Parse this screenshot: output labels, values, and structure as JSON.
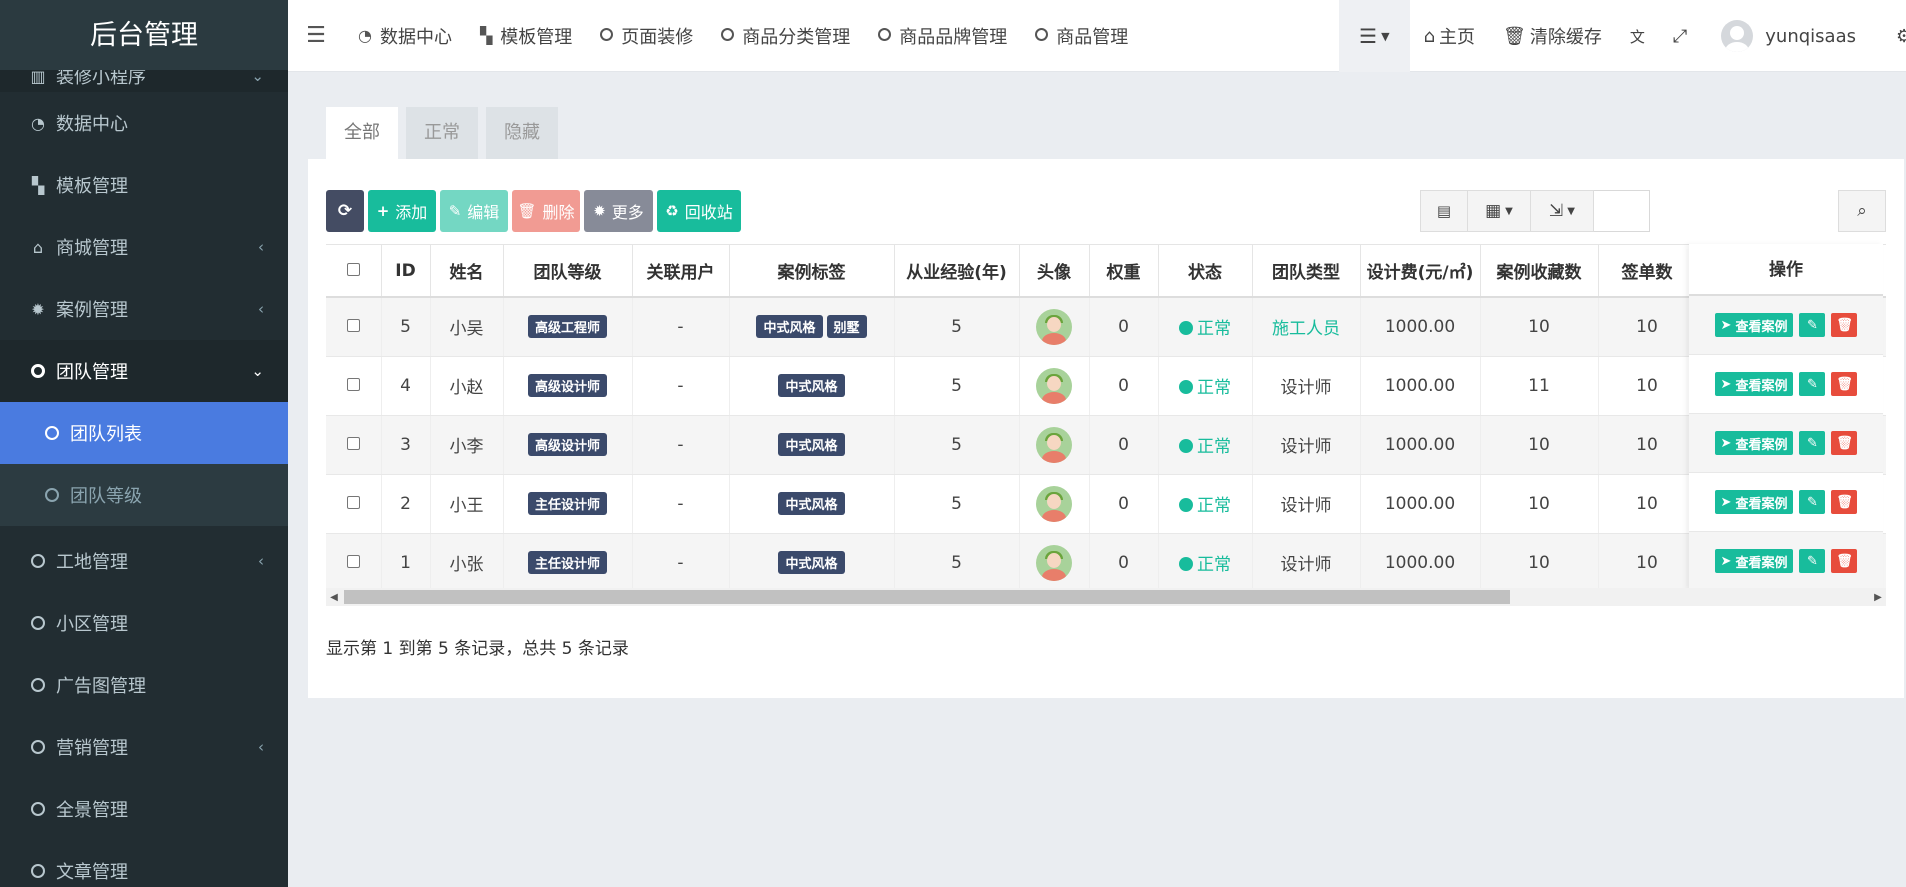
{
  "sidebar": {
    "title": "后台管理",
    "partial_item": "装修小程序",
    "items": [
      {
        "label": "数据中心"
      },
      {
        "label": "模板管理"
      },
      {
        "label": "商城管理"
      },
      {
        "label": "案例管理"
      },
      {
        "label": "团队管理"
      },
      {
        "label": "团队列表"
      },
      {
        "label": "团队等级"
      },
      {
        "label": "工地管理"
      },
      {
        "label": "小区管理"
      },
      {
        "label": "广告图管理"
      },
      {
        "label": "营销管理"
      },
      {
        "label": "全景管理"
      },
      {
        "label": "文章管理"
      }
    ]
  },
  "topnav": {
    "tabs": [
      "数据中心",
      "模板管理",
      "页面装修",
      "商品分类管理",
      "商品品牌管理",
      "商品管理"
    ],
    "home": "主页",
    "clear_cache": "清除缓存",
    "username": "yunqisaas"
  },
  "tabs": [
    "全部",
    "正常",
    "隐藏"
  ],
  "toolbar": {
    "add": "添加",
    "edit": "编辑",
    "delete": "删除",
    "more": "更多",
    "recycle": "回收站",
    "search_placeholder": "搜索"
  },
  "table": {
    "columns": [
      "ID",
      "姓名",
      "团队等级",
      "关联用户",
      "案例标签",
      "从业经验(年)",
      "头像",
      "权重",
      "状态",
      "团队类型",
      "设计费(元/㎡)",
      "案例收藏数",
      "签单数",
      "操作"
    ],
    "rows": [
      {
        "id": "5",
        "name": "小吴",
        "level": "高级工程师",
        "user": "-",
        "tags": [
          "中式风格",
          "别墅"
        ],
        "exp": "5",
        "weight": "0",
        "status": "正常",
        "type": "施工人员",
        "fee": "1000.00",
        "fav": "10",
        "orders": "10"
      },
      {
        "id": "4",
        "name": "小赵",
        "level": "高级设计师",
        "user": "-",
        "tags": [
          "中式风格"
        ],
        "exp": "5",
        "weight": "0",
        "status": "正常",
        "type": "设计师",
        "fee": "1000.00",
        "fav": "11",
        "orders": "10"
      },
      {
        "id": "3",
        "name": "小李",
        "level": "高级设计师",
        "user": "-",
        "tags": [
          "中式风格"
        ],
        "exp": "5",
        "weight": "0",
        "status": "正常",
        "type": "设计师",
        "fee": "1000.00",
        "fav": "10",
        "orders": "10"
      },
      {
        "id": "2",
        "name": "小王",
        "level": "主任设计师",
        "user": "-",
        "tags": [
          "中式风格"
        ],
        "exp": "5",
        "weight": "0",
        "status": "正常",
        "type": "设计师",
        "fee": "1000.00",
        "fav": "10",
        "orders": "10"
      },
      {
        "id": "1",
        "name": "小张",
        "level": "主任设计师",
        "user": "-",
        "tags": [
          "中式风格"
        ],
        "exp": "5",
        "weight": "0",
        "status": "正常",
        "type": "设计师",
        "fee": "1000.00",
        "fav": "10",
        "orders": "10"
      }
    ],
    "view_cases": "查看案例"
  },
  "pager_text": "显示第 1 到第 5 条记录，总共 5 条记录",
  "colors": {
    "sidebar": "#222d32",
    "active": "#4a7be0",
    "teal": "#18bc9c",
    "danger": "#e74c3c"
  }
}
